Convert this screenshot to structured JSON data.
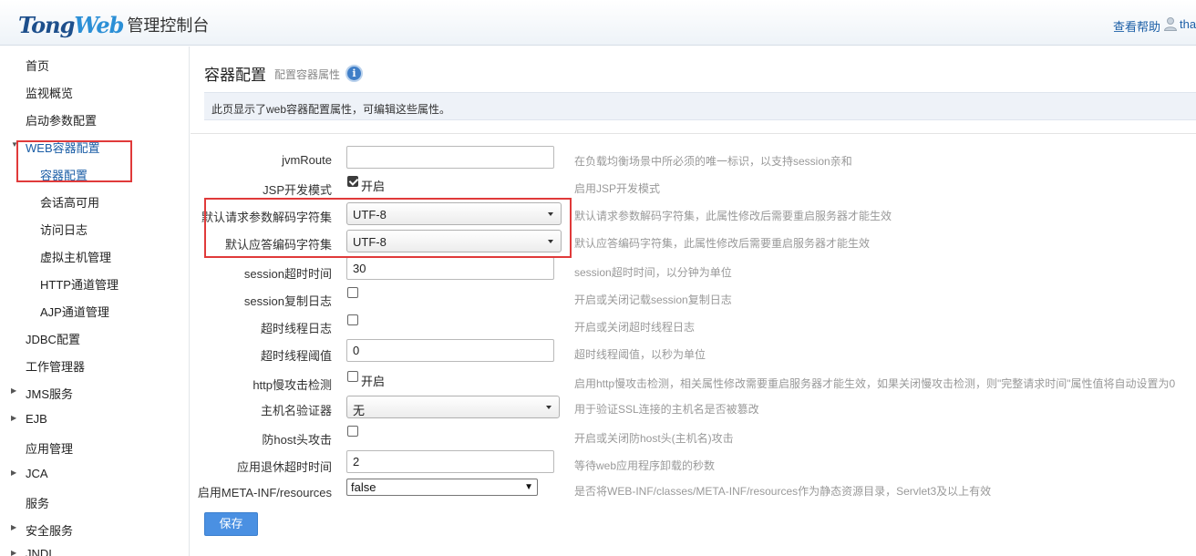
{
  "header": {
    "logo_part1": "Tong",
    "logo_part2": "Web",
    "logo_subtitle": "管理控制台",
    "help_link": "查看帮助",
    "user_name": "tha"
  },
  "sidebar": {
    "items": [
      {
        "label": "首页"
      },
      {
        "label": "监视概览"
      },
      {
        "label": "启动参数配置"
      },
      {
        "label": "WEB容器配置"
      },
      {
        "label": "容器配置"
      },
      {
        "label": "会话高可用"
      },
      {
        "label": "访问日志"
      },
      {
        "label": "虚拟主机管理"
      },
      {
        "label": "HTTP通道管理"
      },
      {
        "label": "AJP通道管理"
      },
      {
        "label": "JDBC配置"
      },
      {
        "label": "工作管理器"
      },
      {
        "label": "JMS服务"
      },
      {
        "label": "EJB"
      },
      {
        "label": "应用管理"
      },
      {
        "label": "JCA"
      },
      {
        "label": "服务"
      },
      {
        "label": "安全服务"
      },
      {
        "label": "JNDI"
      }
    ]
  },
  "main": {
    "title": "容器配置",
    "subtitle": "配置容器属性",
    "info_icon": "i",
    "info_text": "此页显示了web容器配置属性，可编辑这些属性。",
    "rows": [
      {
        "label": "jvmRoute",
        "value": "",
        "desc": "在负载均衡场景中所必须的唯一标识，以支持session亲和"
      },
      {
        "label": "JSP开发模式",
        "check_label": "开启",
        "checked": true,
        "desc": "启用JSP开发模式"
      },
      {
        "label": "默认请求参数解码字符集",
        "value": "UTF-8",
        "desc": "默认请求参数解码字符集，此属性修改后需要重启服务器才能生效"
      },
      {
        "label": "默认应答编码字符集",
        "value": "UTF-8",
        "desc": "默认应答编码字符集，此属性修改后需要重启服务器才能生效"
      },
      {
        "label": "session超时时间",
        "value": "30",
        "desc": "session超时时间，以分钟为单位"
      },
      {
        "label": "session复制日志",
        "checked": false,
        "desc": "开启或关闭记载session复制日志"
      },
      {
        "label": "超时线程日志",
        "checked": false,
        "desc": "开启或关闭超时线程日志"
      },
      {
        "label": "超时线程阈值",
        "value": "0",
        "desc": "超时线程阈值，以秒为单位"
      },
      {
        "label": "http慢攻击检测",
        "check_label": "开启",
        "checked": false,
        "desc": "启用http慢攻击检测，相关属性修改需要重启服务器才能生效，如果关闭慢攻击检测，则\"完整请求时间\"属性值将自动设置为0"
      },
      {
        "label": "主机名验证器",
        "value": "无",
        "desc": "用于验证SSL连接的主机名是否被篡改"
      },
      {
        "label": "防host头攻击",
        "checked": false,
        "desc": "开启或关闭防host头(主机名)攻击"
      },
      {
        "label": "应用退休超时时间",
        "value": "2",
        "desc": "等待web应用程序卸载的秒数"
      },
      {
        "label": "启用META-INF/resources",
        "value": "false",
        "desc": "是否将WEB-INF/classes/META-INF/resources作为静态资源目录，Servlet3及以上有效"
      }
    ],
    "save_label": "保存"
  }
}
